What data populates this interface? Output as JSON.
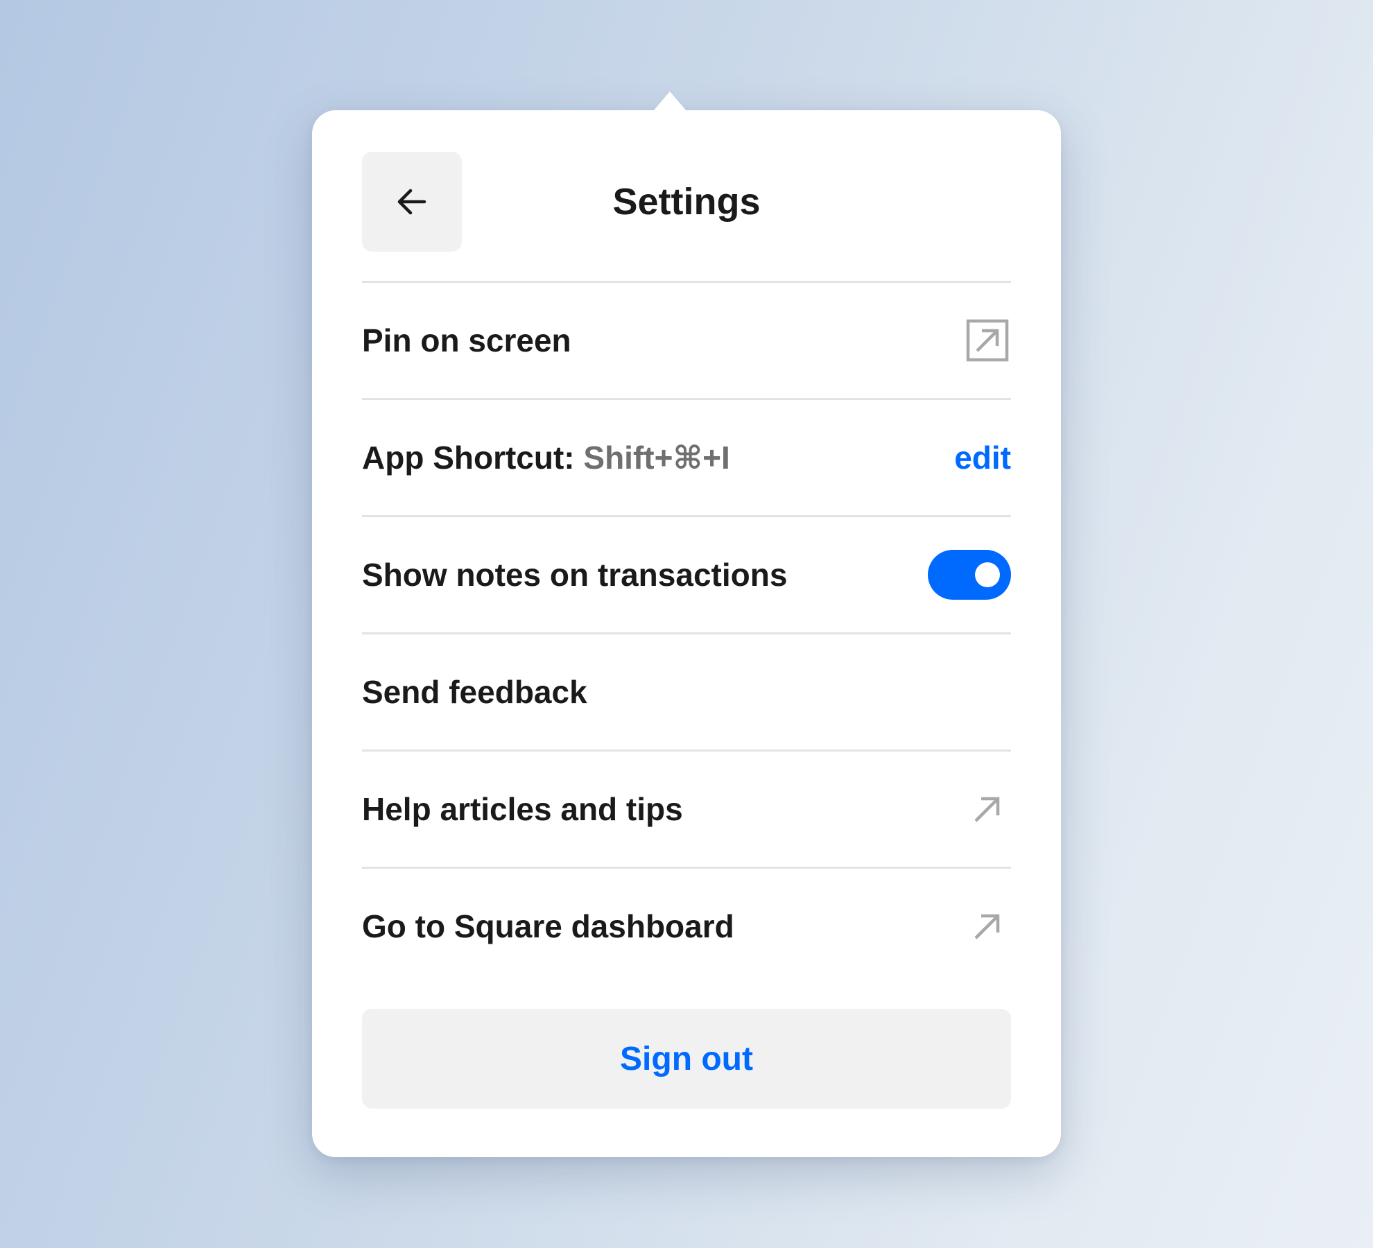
{
  "header": {
    "title": "Settings",
    "back_icon": "arrow-left-icon"
  },
  "rows": {
    "pin": {
      "label": "Pin on screen",
      "icon": "pin-window-icon"
    },
    "shortcut": {
      "label": "App Shortcut:",
      "value": "Shift+⌘+I",
      "action_label": "edit"
    },
    "notes": {
      "label": "Show notes on transactions",
      "toggle_on": true
    },
    "feedback": {
      "label": "Send feedback"
    },
    "help": {
      "label": "Help articles and tips",
      "icon": "external-link-arrow-icon"
    },
    "dashboard": {
      "label": "Go to Square dashboard",
      "icon": "external-link-arrow-icon"
    }
  },
  "footer": {
    "signout_label": "Sign out"
  },
  "colors": {
    "accent": "#006aff",
    "text": "#1a1a1a",
    "muted_text": "#6f6f6f",
    "button_bg": "#f1f1f1",
    "divider": "#e3e3e3",
    "icon_gray": "#a8a8a8"
  }
}
